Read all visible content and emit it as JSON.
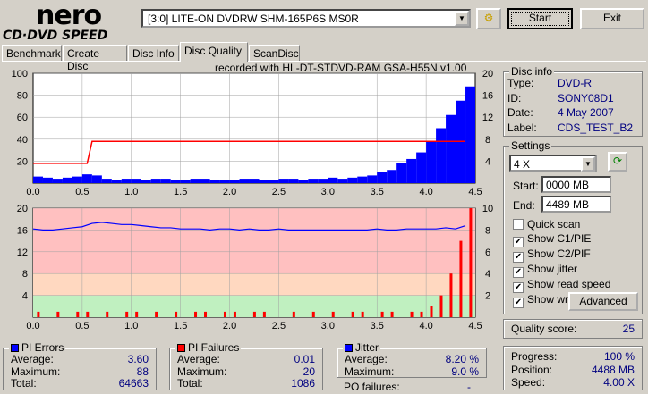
{
  "app": {
    "logo_top": "nero",
    "logo_bottom": "CD·DVD SPEED"
  },
  "toolbar": {
    "drive": "[3:0]  LITE-ON DVDRW SHM-165P6S MS0R",
    "start_label": "Start",
    "exit_label": "Exit"
  },
  "tabs": [
    "Benchmark",
    "Create Disc",
    "Disc Info",
    "Disc Quality",
    "ScanDisc"
  ],
  "active_tab": "Disc Quality",
  "recorded_with": "recorded with HL-DT-STDVD-RAM GSA-H55N v1.00",
  "disc_info": {
    "title": "Disc info",
    "type_label": "Type:",
    "type": "DVD-R",
    "id_label": "ID:",
    "id": "SONY08D1",
    "date_label": "Date:",
    "date": "4 May 2007",
    "label_label": "Label:",
    "label": "CDS_TEST_B2"
  },
  "settings": {
    "title": "Settings",
    "speed": "4 X",
    "start_label": "Start:",
    "start": "0000 MB",
    "end_label": "End:",
    "end": "4489 MB",
    "checks": [
      {
        "label": "Quick scan",
        "checked": false
      },
      {
        "label": "Show C1/PIE",
        "checked": true
      },
      {
        "label": "Show C2/PIF",
        "checked": true
      },
      {
        "label": "Show jitter",
        "checked": true
      },
      {
        "label": "Show read speed",
        "checked": true
      },
      {
        "label": "Show write speed",
        "checked": true
      }
    ],
    "advanced_label": "Advanced"
  },
  "quality": {
    "label": "Quality score:",
    "value": "25"
  },
  "progress": {
    "progress_label": "Progress:",
    "progress": "100 %",
    "position_label": "Position:",
    "position": "4488 MB",
    "speed_label": "Speed:",
    "speed": "4.00 X"
  },
  "pi_errors": {
    "title": "PI Errors",
    "avg_label": "Average:",
    "avg": "3.60",
    "max_label": "Maximum:",
    "max": "88",
    "total_label": "Total:",
    "total": "64663"
  },
  "pi_failures": {
    "title": "PI Failures",
    "avg_label": "Average:",
    "avg": "0.01",
    "max_label": "Maximum:",
    "max": "20",
    "total_label": "Total:",
    "total": "1086"
  },
  "jitter": {
    "title": "Jitter",
    "avg_label": "Average:",
    "avg": "8.20 %",
    "max_label": "Maximum:",
    "max": "9.0 %",
    "po_label": "PO failures:",
    "po": "-"
  },
  "colors": {
    "pie": "#0000ff",
    "pif": "#ff0000",
    "jitter": "#0000ff",
    "speed": "#ff0000"
  },
  "chart_data": [
    {
      "type": "bar",
      "name": "PI errors / read speed",
      "xlim": [
        0,
        4.5
      ],
      "ylim": [
        0,
        100
      ],
      "y2lim": [
        0,
        20
      ],
      "xticks": [
        "0.0",
        "0.5",
        "1.0",
        "1.5",
        "2.0",
        "2.5",
        "3.0",
        "3.5",
        "4.0",
        "4.5"
      ],
      "yticks": [
        "20",
        "40",
        "60",
        "80",
        "100"
      ],
      "y2ticks": [
        "4",
        "8",
        "12",
        "16",
        "20"
      ],
      "x": [
        0.0,
        0.1,
        0.2,
        0.3,
        0.4,
        0.5,
        0.6,
        0.7,
        0.8,
        0.9,
        1.0,
        1.1,
        1.2,
        1.3,
        1.4,
        1.5,
        1.6,
        1.7,
        1.8,
        1.9,
        2.0,
        2.1,
        2.2,
        2.3,
        2.4,
        2.5,
        2.6,
        2.7,
        2.8,
        2.9,
        3.0,
        3.1,
        3.2,
        3.3,
        3.4,
        3.5,
        3.6,
        3.7,
        3.8,
        3.9,
        4.0,
        4.1,
        4.2,
        4.3,
        4.4
      ],
      "pi_errors": [
        6,
        5,
        4,
        5,
        6,
        8,
        7,
        4,
        3,
        4,
        4,
        3,
        4,
        4,
        3,
        3,
        4,
        4,
        3,
        3,
        3,
        4,
        4,
        3,
        3,
        4,
        4,
        3,
        4,
        4,
        5,
        4,
        5,
        6,
        7,
        10,
        12,
        18,
        22,
        28,
        38,
        50,
        62,
        75,
        88
      ],
      "read_speed": [
        {
          "x": 0.0,
          "y": 3.6
        },
        {
          "x": 0.4,
          "y": 3.6
        },
        {
          "x": 0.55,
          "y": 3.6
        },
        {
          "x": 0.6,
          "y": 7.6
        },
        {
          "x": 4.4,
          "y": 7.6
        }
      ]
    },
    {
      "type": "bar",
      "name": "PI failures / jitter",
      "xlim": [
        0,
        4.5
      ],
      "ylim": [
        0,
        20
      ],
      "y2lim": [
        0,
        10
      ],
      "xticks": [
        "0.0",
        "0.5",
        "1.0",
        "1.5",
        "2.0",
        "2.5",
        "3.0",
        "3.5",
        "4.0",
        "4.5"
      ],
      "yticks": [
        "4",
        "8",
        "12",
        "16",
        "20"
      ],
      "y2ticks": [
        "2",
        "4",
        "6",
        "8",
        "10"
      ],
      "pi_failures": [
        1,
        0,
        1,
        0,
        1,
        1,
        0,
        1,
        0,
        1,
        1,
        0,
        1,
        0,
        1,
        0,
        1,
        1,
        0,
        1,
        1,
        0,
        1,
        1,
        0,
        0,
        1,
        0,
        1,
        0,
        1,
        0,
        1,
        1,
        0,
        1,
        1,
        0,
        1,
        1,
        2,
        4,
        8,
        14,
        20
      ],
      "jitter": [
        8.1,
        8.0,
        8.0,
        8.1,
        8.2,
        8.3,
        8.6,
        8.7,
        8.6,
        8.5,
        8.5,
        8.4,
        8.3,
        8.2,
        8.2,
        8.1,
        8.1,
        8.1,
        8.0,
        8.1,
        8.1,
        8.0,
        8.1,
        8.0,
        8.0,
        8.1,
        8.0,
        8.0,
        8.0,
        8.0,
        8.0,
        8.0,
        8.0,
        8.0,
        8.0,
        8.1,
        8.0,
        8.0,
        8.1,
        8.1,
        8.1,
        8.1,
        8.2,
        8.1,
        8.4
      ]
    }
  ]
}
